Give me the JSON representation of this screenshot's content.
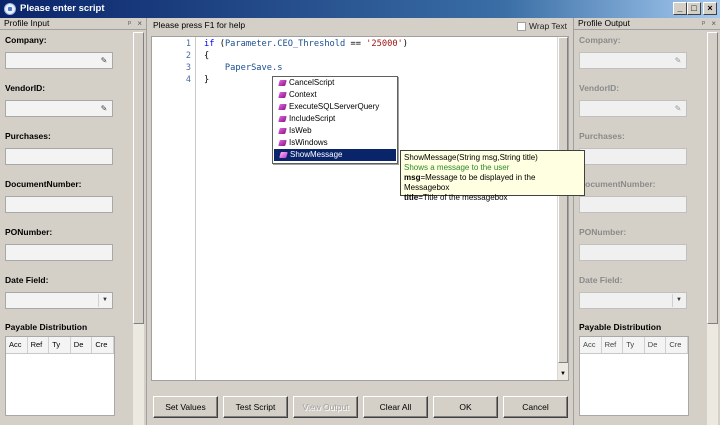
{
  "window": {
    "title": "Please enter script",
    "min_glyph": "_",
    "max_glyph": "□",
    "close_glyph": "×"
  },
  "left_panel": {
    "title": "Profile Input",
    "pin_glyph": "ᵖ",
    "close_glyph": "×",
    "fields": [
      {
        "label": "Company:",
        "value": ""
      },
      {
        "label": "VendorID:",
        "value": ""
      },
      {
        "label": "Purchases:",
        "value": ""
      },
      {
        "label": "DocumentNumber:",
        "value": ""
      },
      {
        "label": "PONumber:",
        "value": ""
      },
      {
        "label": "Date Field:",
        "value": ""
      }
    ],
    "distribution_label": "Payable Distribution",
    "columns": [
      "Acc",
      "Ref",
      "Ty",
      "De",
      "Cre"
    ]
  },
  "right_panel": {
    "title": "Profile Output",
    "pin_glyph": "ᵖ",
    "close_glyph": "×",
    "fields": [
      {
        "label": "Company:",
        "value": ""
      },
      {
        "label": "VendorID:",
        "value": ""
      },
      {
        "label": "Purchases:",
        "value": ""
      },
      {
        "label": "DocumentNumber:",
        "value": ""
      },
      {
        "label": "PONumber:",
        "value": ""
      },
      {
        "label": "Date Field:",
        "value": ""
      }
    ],
    "distribution_label": "Payable Distribution",
    "columns": [
      "Acc",
      "Ref",
      "Ty",
      "De",
      "Cre"
    ]
  },
  "editor": {
    "help_text": "Please press F1 for help",
    "wrap_label": "Wrap Text",
    "wrap_checked": false,
    "line_numbers": [
      "1",
      "2",
      "3",
      "4"
    ],
    "lines": [
      {
        "kw": "if",
        "open": " (",
        "id": "Parameter.CEO_Threshold",
        "op": " == ",
        "str": "'25000'",
        "close": ")"
      },
      {
        "text": "{"
      },
      {
        "text": "    PaperSave.s"
      },
      {
        "text": "}"
      }
    ]
  },
  "autocomplete": {
    "items": [
      "CancelScript",
      "Context",
      "ExecuteSQLServerQuery",
      "IncludeScript",
      "IsWeb",
      "IsWindows",
      "ShowMessage"
    ],
    "selected_index": 6
  },
  "tooltip": {
    "signature": "ShowMessage(String msg,String title)",
    "description": "Shows a message to the user",
    "params": [
      {
        "name": "msg",
        "desc": "=Message to be displayed in the Messagebox"
      },
      {
        "name": "title",
        "desc": "=Title of the messagebox"
      }
    ]
  },
  "buttons": {
    "set_values": "Set Values",
    "test_script": "Test Script",
    "view_output": "View Output",
    "clear_all": "Clear All",
    "ok": "OK",
    "cancel": "Cancel"
  },
  "colors": {
    "titlebar": "#0a246a",
    "selection": "#0a246a",
    "keyword": "#0000ff",
    "string": "#a31515",
    "tooltip_bg": "#ffffe1",
    "tooltip_desc": "#2a8a2a"
  }
}
